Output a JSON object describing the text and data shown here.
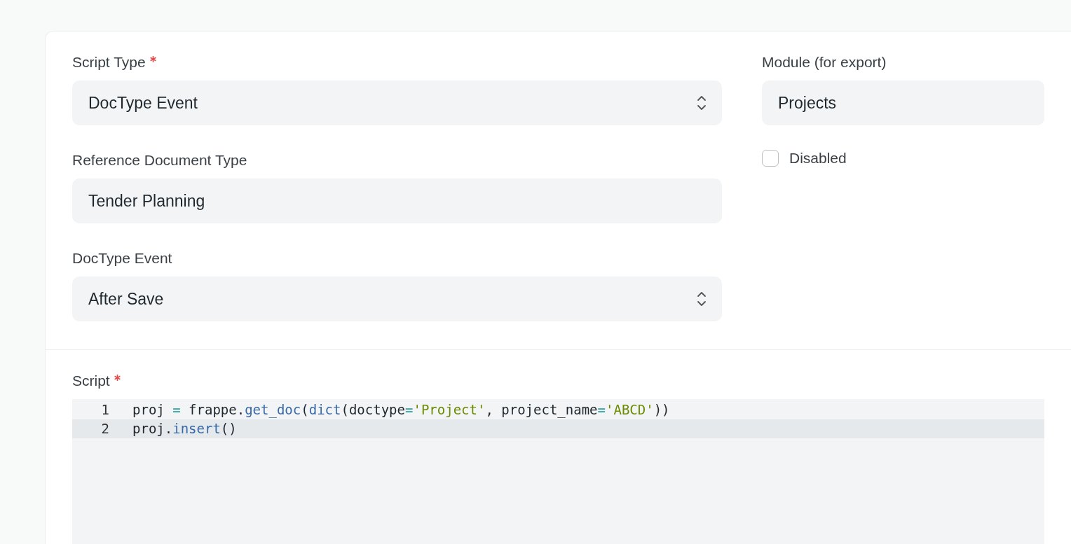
{
  "form": {
    "columns": [
      {
        "fields": [
          {
            "kind": "select",
            "label": "Script Type",
            "required": true,
            "value": "DocType Event"
          },
          {
            "kind": "text",
            "label": "Reference Document Type",
            "required": false,
            "value": "Tender Planning"
          },
          {
            "kind": "select",
            "label": "DocType Event",
            "required": false,
            "value": "After Save"
          }
        ]
      },
      {
        "fields": [
          {
            "kind": "text",
            "label": "Module (for export)",
            "required": false,
            "value": "Projects"
          },
          {
            "kind": "checkbox",
            "label": "Disabled",
            "checked": false
          }
        ]
      }
    ]
  },
  "script": {
    "label": "Script",
    "required": true,
    "lines": [
      {
        "number": "1",
        "selected": false,
        "tokens": [
          {
            "kind": "plain",
            "text": "proj "
          },
          {
            "kind": "operator",
            "text": "="
          },
          {
            "kind": "plain",
            "text": " frappe."
          },
          {
            "kind": "function",
            "text": "get_doc"
          },
          {
            "kind": "plain",
            "text": "("
          },
          {
            "kind": "function",
            "text": "dict"
          },
          {
            "kind": "plain",
            "text": "(doctype"
          },
          {
            "kind": "operator",
            "text": "="
          },
          {
            "kind": "string",
            "text": "'Project'"
          },
          {
            "kind": "plain",
            "text": ", project_name"
          },
          {
            "kind": "operator",
            "text": "="
          },
          {
            "kind": "string",
            "text": "'ABCD'"
          },
          {
            "kind": "plain",
            "text": "))"
          }
        ]
      },
      {
        "number": "2",
        "selected": true,
        "tokens": [
          {
            "kind": "plain",
            "text": "proj."
          },
          {
            "kind": "function",
            "text": "insert"
          },
          {
            "kind": "plain",
            "text": "()"
          }
        ]
      }
    ]
  }
}
